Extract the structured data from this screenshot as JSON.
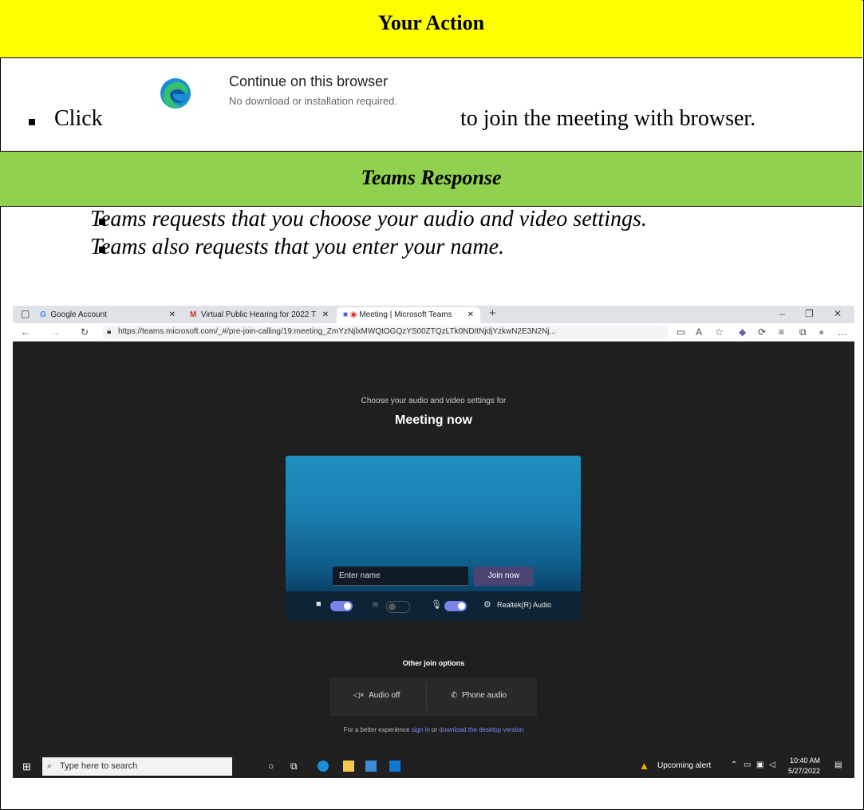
{
  "header": {
    "action_title": "Your Action",
    "response_title": "Teams Response"
  },
  "action": {
    "click_word": "Click",
    "continue_title": "Continue on this browser",
    "continue_sub": "No download or installation required.",
    "tail": "to join the meeting with browser."
  },
  "response": {
    "bullets": [
      "Teams requests that you choose your audio and video settings.",
      "Teams also requests that you enter your name."
    ]
  },
  "browser": {
    "tabs": [
      "Google Account",
      "Virtual Public Hearing for 2022 T",
      "Meeting | Microsoft Teams"
    ],
    "url": "https://teams.microsoft.com/_#/pre-join-calling/19:meeting_ZmYzNjlxMWQtOGQzYS00ZTQzLTk0NDItNjdjYzkwN2E3N2Nj..."
  },
  "prejoin": {
    "choose_text": "Choose your audio and video settings for",
    "meeting_title": "Meeting now",
    "name_placeholder": "Enter name",
    "join_label": "Join now",
    "audio_device": "Realtek(R) Audio",
    "other_options": "Other join options",
    "audio_off": "Audio off",
    "phone_audio": "Phone audio",
    "better_prefix": "For a better experience",
    "sign_in": "sign in",
    "or": "or",
    "download": "download the desktop version"
  },
  "taskbar": {
    "search_placeholder": "Type here to search",
    "alert": "Upcoming alert",
    "time": "10:40 AM",
    "date": "5/27/2022"
  }
}
